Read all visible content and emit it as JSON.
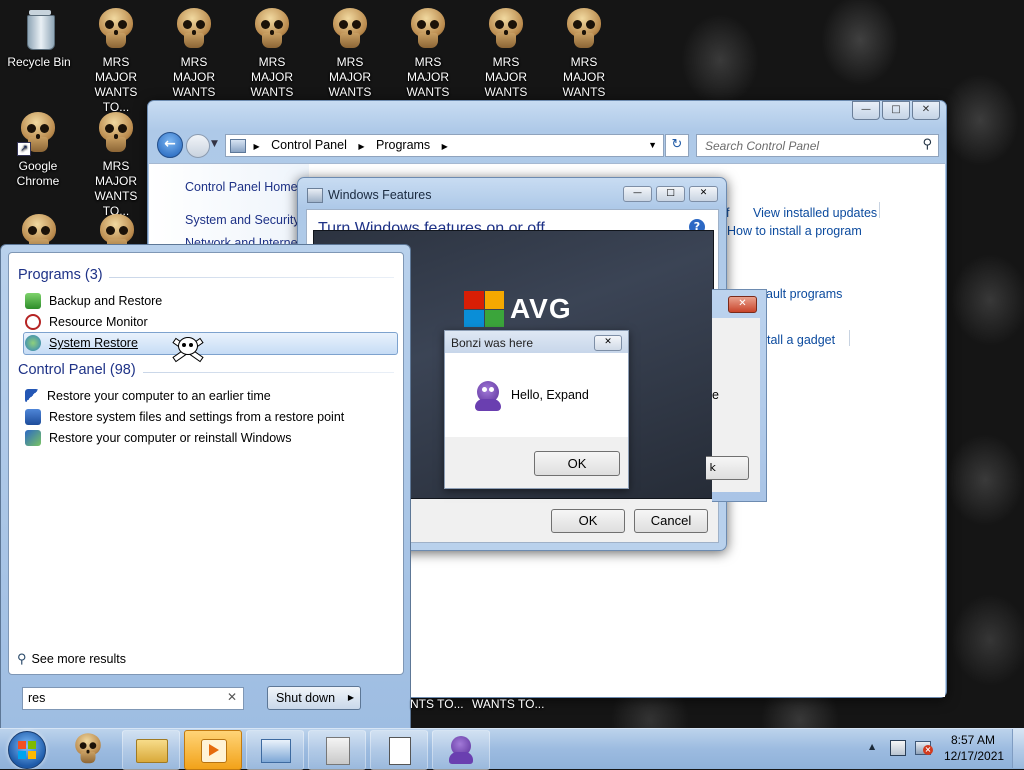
{
  "desktop": {
    "icons": [
      {
        "label": "Recycle Bin",
        "type": "recycle-bin"
      },
      {
        "label": "MRS MAJOR WANTS TO..."
      },
      {
        "label": "MRS MAJOR WANTS TO..."
      },
      {
        "label": "MRS MAJOR WANTS TO..."
      },
      {
        "label": "MRS MAJOR WANTS TO..."
      },
      {
        "label": "MRS MAJOR WANTS TO..."
      },
      {
        "label": "MRS MAJOR WANTS TO..."
      },
      {
        "label": "MRS MAJOR WANTS TO..."
      },
      {
        "label": "Google Chrome"
      },
      {
        "label": "MRS MAJOR WANTS TO..."
      }
    ],
    "bottom_labels": [
      "NTS TO...",
      "WANTS TO..."
    ]
  },
  "control_panel": {
    "breadcrumb": [
      "Control Panel",
      "Programs"
    ],
    "search_placeholder": "Search Control Panel",
    "left_nav": [
      "Control Panel Home",
      "System and Security",
      "Network and Internet"
    ],
    "right_links": {
      "view_installed_updates": "View installed updates",
      "f_fragment": "f",
      "how_to_install": "How to install a program",
      "default_programs": "ault programs",
      "gadget": "tall a gadget",
      "e_fragment": "e"
    }
  },
  "windows_features": {
    "title": "Windows Features",
    "heading": "Turn Windows features on or off",
    "ok": "OK",
    "cancel": "Cancel"
  },
  "avg": {
    "logo_text": "AVG"
  },
  "bonzi_dialog": {
    "title": "Bonzi was here",
    "message": "Hello, Expand",
    "ok": "OK"
  },
  "start_menu": {
    "programs_header": "Programs (3)",
    "programs": [
      "Backup and Restore",
      "Resource Monitor",
      "System Restore"
    ],
    "control_panel_header": "Control Panel (98)",
    "control_panel_items": [
      "Restore your computer to an earlier time",
      "Restore system files and settings from a restore point",
      "Restore your computer or reinstall Windows"
    ],
    "see_more": "See more results",
    "search_value": "res",
    "shutdown": "Shut down"
  },
  "taskbar": {
    "time": "8:57 AM",
    "date": "12/17/2021"
  },
  "colors": {
    "accent": "#1e3287",
    "link": "#0b4a9e",
    "avg_red": "#d81e05"
  }
}
